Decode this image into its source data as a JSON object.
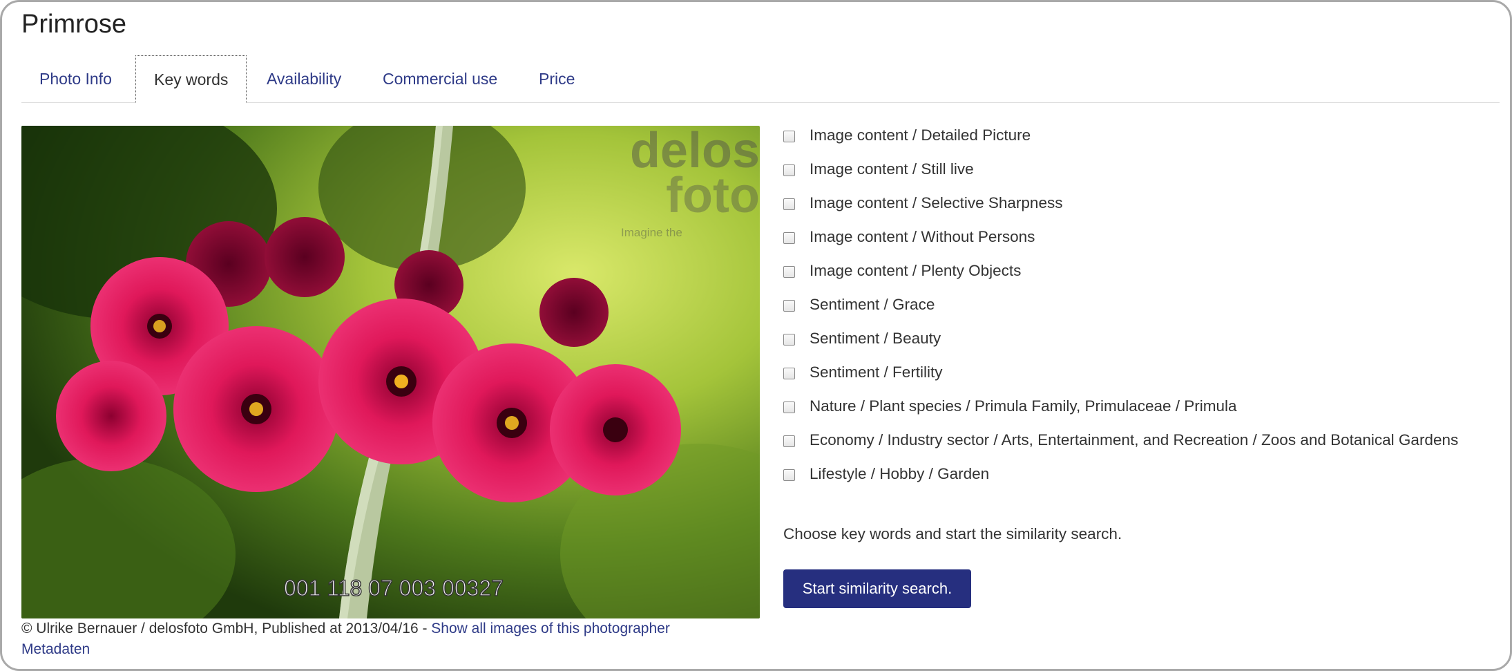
{
  "page": {
    "title": "Primrose"
  },
  "tabs": [
    {
      "label": "Photo Info"
    },
    {
      "label": "Key words"
    },
    {
      "label": "Availability"
    },
    {
      "label": "Commercial use"
    },
    {
      "label": "Price"
    }
  ],
  "photo": {
    "watermark_brand": "delos foto",
    "watermark_tagline": "Imagine the",
    "image_number": "001 118 07 003 00327"
  },
  "credit": {
    "text": "© Ulrike Bernauer / delosfoto GmbH, Published at 2013/04/16 - ",
    "link": "Show all images of this photographer",
    "metadata_link": "Metadaten"
  },
  "keywords": [
    {
      "label": "Image content / Detailed Picture",
      "checked": false
    },
    {
      "label": "Image content / Still live",
      "checked": false
    },
    {
      "label": "Image content / Selective Sharpness",
      "checked": false
    },
    {
      "label": "Image content / Without Persons",
      "checked": false
    },
    {
      "label": "Image content / Plenty Objects",
      "checked": false
    },
    {
      "label": "Sentiment / Grace",
      "checked": false
    },
    {
      "label": "Sentiment / Beauty",
      "checked": false
    },
    {
      "label": "Sentiment / Fertility",
      "checked": false
    },
    {
      "label": "Nature / Plant species / Primula Family, Primulaceae / Primula",
      "checked": false
    },
    {
      "label": "Economy / Industry sector / Arts, Entertainment, and Recreation / Zoos and Botanical Gardens",
      "checked": false
    },
    {
      "label": "Lifestyle / Hobby / Garden",
      "checked": false
    }
  ],
  "search": {
    "hint": "Choose key words and start the similarity search.",
    "button_label": "Start similarity search."
  },
  "colors": {
    "link": "#2e3a87",
    "button_bg": "#262f7f",
    "flower": "#d81b60"
  }
}
